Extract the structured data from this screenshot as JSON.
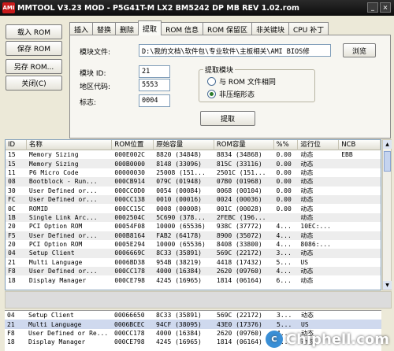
{
  "window": {
    "title": "MMTOOL V3.23 MOD - P5G41T-M LX2 BM5242 DP MB REV 1.02.rom",
    "icon_label": "AMI"
  },
  "sidebar": {
    "load_rom": "载入 ROM",
    "save_rom": "保存 ROM",
    "save_as": "另存 ROM...",
    "close": "关闭(C)"
  },
  "tabs": [
    "插入",
    "替换",
    "删除",
    "提取",
    "ROM 信息",
    "ROM 保留区",
    "非关键块",
    "CPU 补丁"
  ],
  "active_tab": 3,
  "extract": {
    "module_file_label": "模块文件:",
    "module_file_value": "D:\\我的文档\\软件包\\专业软件\\主板相关\\AMI BIOS修",
    "browse": "浏览",
    "module_id_label": "模块 ID:",
    "module_id_value": "21",
    "region_label": "地区代码:",
    "region_value": "5553",
    "flag_label": "标志:",
    "flag_value": "0004",
    "group_title": "提取模块",
    "option_rom_same": "与 ROM 文件相同",
    "option_uncompressed": "非压缩形态",
    "extract_button": "提取"
  },
  "table": {
    "headers": [
      "ID",
      "名称",
      "ROM位置",
      "原始容量",
      "ROM容量",
      "%%",
      "运行位",
      "NCB"
    ],
    "rows": [
      [
        "15",
        "Memory Sizing",
        "000E002C",
        "8820 (34848)",
        "8834 (34868)",
        "0.00",
        "动态",
        "EBB"
      ],
      [
        "15",
        "Memory Sizing",
        "000B0000",
        "8148 (33096)",
        "815C (33116)",
        "0.00",
        "动态",
        ""
      ],
      [
        "11",
        "P6 Micro Code",
        "00000030",
        "25008 (151...",
        "2501C (151...",
        "0.00",
        "动态",
        ""
      ],
      [
        "08",
        "Bootblock - Run...",
        "000CB914",
        "079C (01948)",
        "07B0 (01968)",
        "0.00",
        "动态",
        ""
      ],
      [
        "30",
        "User Defined or...",
        "000CC0D0",
        "0054 (00084)",
        "0068 (00104)",
        "0.00",
        "动态",
        ""
      ],
      [
        "FC",
        "User Defined or...",
        "000CC138",
        "0010 (00016)",
        "0024 (00036)",
        "0.00",
        "动态",
        ""
      ],
      [
        "0C",
        "ROMID",
        "000CC15C",
        "0008 (00008)",
        "001C (00028)",
        "0.00",
        "动态",
        ""
      ],
      [
        "1B",
        "Single Link Arc...",
        "0002504C",
        "5C690 (378...",
        "2FEBC (196...",
        "",
        "动态",
        ""
      ],
      [
        "20",
        "PCI Option ROM",
        "00054F08",
        "10000 (65536)",
        "938C (37772)",
        "4...",
        "10EC:...",
        ""
      ],
      [
        "F5",
        "User Defined or...",
        "000B8164",
        "FAB2 (64178)",
        "8900 (35072)",
        "4...",
        "动态",
        ""
      ],
      [
        "20",
        "PCI Option ROM",
        "0005E294",
        "10000 (65536)",
        "8408 (33800)",
        "4...",
        "8086:...",
        ""
      ],
      [
        "04",
        "Setup Client",
        "0006669C",
        "8C33 (35891)",
        "569C (22172)",
        "3...",
        "动态",
        ""
      ],
      [
        "21",
        "Multi Language",
        "0006BD38",
        "954B (38219)",
        "4418 (17432)",
        "5...",
        "US",
        ""
      ],
      [
        "F8",
        "User Defined or...",
        "000CC178",
        "4000 (16384)",
        "2620 (09760)",
        "4...",
        "动态",
        ""
      ],
      [
        "18",
        "Display Manager",
        "000CE798",
        "4245 (16965)",
        "1814 (06164)",
        "6...",
        "动态",
        ""
      ]
    ],
    "bottom_rows": [
      [
        "04",
        "Setup Client",
        "00066650",
        "8C33 (35891)",
        "569C (22172)",
        "3...",
        "动态",
        ""
      ],
      [
        "21",
        "Multi Language",
        "0006BCEC",
        "94CF (38095)",
        "43E0 (17376)",
        "5...",
        "US",
        ""
      ],
      [
        "F8",
        "User Defined or Re...",
        "000CC178",
        "4000 (16384)",
        "2620 (09760)",
        "4...",
        "动态",
        ""
      ],
      [
        "18",
        "Display Manager",
        "000CE798",
        "4245 (16965)",
        "1814 (06164)",
        "6...",
        "动态",
        ""
      ]
    ]
  },
  "watermark": {
    "text": "Chiphell.com",
    "logo": "C"
  }
}
